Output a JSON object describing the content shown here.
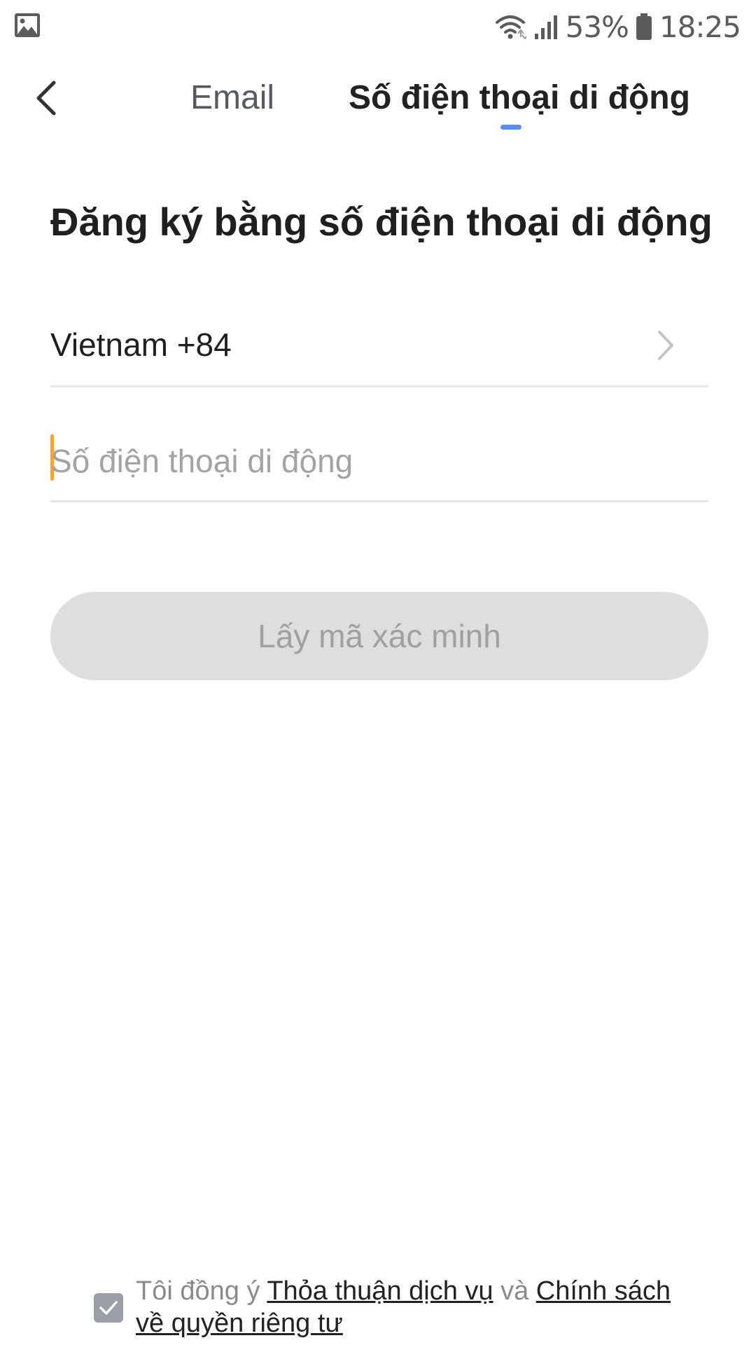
{
  "status_bar": {
    "battery_percent": "53%",
    "time": "18:25",
    "icons": [
      "gallery-icon",
      "wifi-icon",
      "signal-icon",
      "battery-icon"
    ]
  },
  "header": {
    "tabs": [
      {
        "label": "Email",
        "active": false
      },
      {
        "label": "Số điện thoại di động",
        "active": true
      }
    ],
    "accent_color": "#5b8def"
  },
  "main": {
    "title": "Đăng ký bằng số điện thoại di động",
    "country": {
      "label": "Vietnam +84"
    },
    "phone_input": {
      "value": "",
      "placeholder": "Số điện thoại di động"
    },
    "verify_button": {
      "label": "Lấy mã xác minh",
      "enabled": false
    }
  },
  "agreement": {
    "checked": true,
    "prefix": "Tôi đồng ý ",
    "terms_link": "Thỏa thuận dịch vụ",
    "conjunction": " và ",
    "privacy_link": "Chính sách về quyền riêng tư"
  },
  "colors": {
    "caret": "#f5a33a",
    "button_disabled_bg": "#dedede",
    "button_disabled_text": "#a0a0a0"
  }
}
